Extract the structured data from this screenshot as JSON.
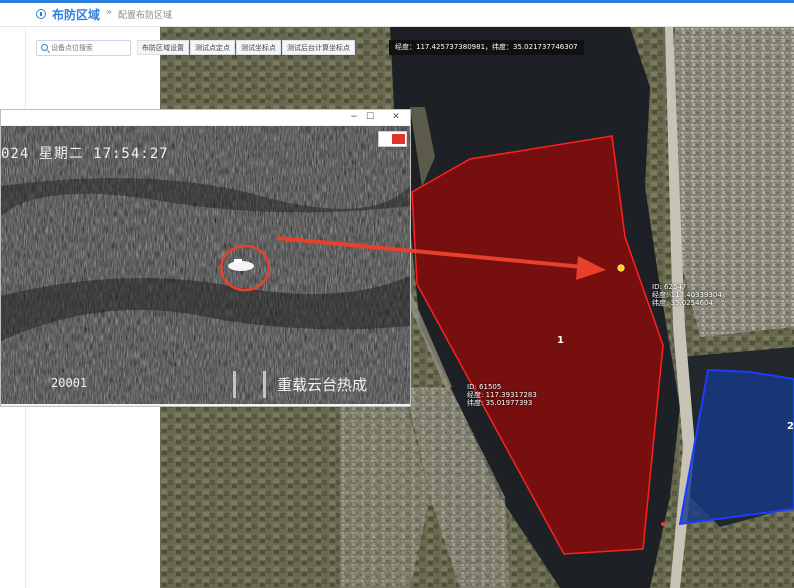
{
  "header": {
    "title": "布防区域",
    "separator": "»",
    "breadcrumb": "配置布防区域",
    "info_icon": "info-circle-icon"
  },
  "sidebar": {
    "search_placeholder": "设备点位搜索",
    "search_icon": "search-icon"
  },
  "toolbar": {
    "buttons": [
      "布防区域设置",
      "测试点定点",
      "测试坐标点",
      "测试后台计算坐标点"
    ]
  },
  "coordinate_readout": "经度：117.425737380981，纬度：35.021737746307",
  "video_window": {
    "controls": [
      "−",
      "☐",
      "✕"
    ],
    "timestamp": "024  星期二  17:54:27",
    "frame_counter": "20001",
    "camera_name": "重载云台热成",
    "record_icon": "record-icon"
  },
  "map": {
    "zones": [
      {
        "label": "1",
        "color": "#8b0b0b"
      },
      {
        "label": "2",
        "color": "#173a8a"
      }
    ],
    "markers": [
      {
        "id_line": "ID: 62547",
        "lng_line": "经度: 117.40339304",
        "lat_line": "纬度: 35.0254604"
      },
      {
        "id_line": "ID: 61505",
        "lng_line": "经度: 117.39317283",
        "lat_line": "纬度: 35.01977393"
      }
    ],
    "target_color": "#ffd200",
    "highlight_color": "#e8402a"
  }
}
